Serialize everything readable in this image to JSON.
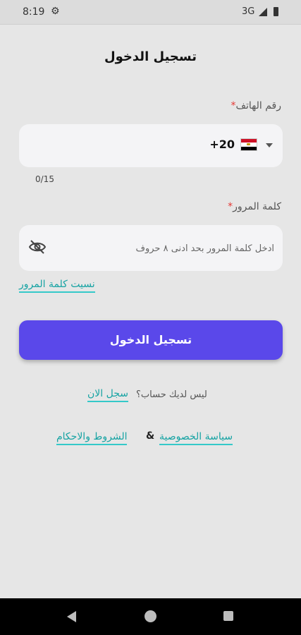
{
  "status_bar": {
    "time": "8:19",
    "network": "3G",
    "icons": [
      "settings-icon",
      "signal-icon",
      "battery-icon"
    ]
  },
  "screen": {
    "title": "تسجيل الدخول"
  },
  "phone": {
    "label": "رقم الهاتف",
    "required_mark": "*",
    "country_flag": "egypt-flag-icon",
    "country_code": "+20",
    "value": "",
    "counter": "0/15"
  },
  "password": {
    "label": "كلمة المرور",
    "required_mark": "*",
    "placeholder": "ادخل كلمة المرور بحد ادنى ٨ حروف",
    "visibility_icon": "eye-off-icon"
  },
  "links": {
    "forgot_password": "نسيت كلمة المرور",
    "no_account": "ليس لديك حساب؟",
    "register": "سجل الان",
    "privacy": "سياسة الخصوصية",
    "ampersand": "&",
    "terms": "الشروط والاحكام"
  },
  "button": {
    "login": "تسجيل الدخول"
  },
  "colors": {
    "background": "#e6e6e6",
    "primary_button": "#5a48ea",
    "link": "#16a3a3",
    "required": "#e53935"
  },
  "nav_bar": {
    "icons": [
      "back-icon",
      "home-icon",
      "recents-icon"
    ]
  }
}
